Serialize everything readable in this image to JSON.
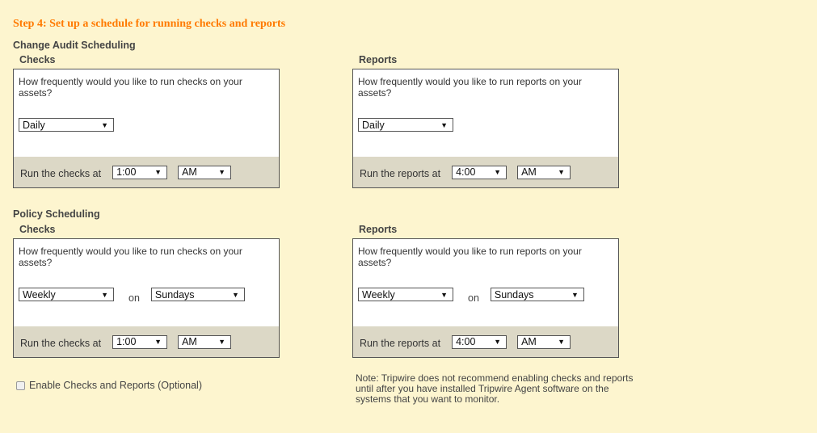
{
  "step_title": "Step 4: Set up a schedule for running checks and reports",
  "question_text": "How frequently would you like to run checks on your assets?",
  "sections": [
    {
      "title": "Change Audit Scheduling",
      "checks": {
        "label": "Checks",
        "question": "How frequently would you like to run checks on your assets?",
        "frequency": "Daily",
        "run_label": "Run the checks at",
        "time": "1:00",
        "ampm": "AM"
      },
      "reports": {
        "label": "Reports",
        "question": "How frequently would you like to run reports on your assets?",
        "frequency": "Daily",
        "run_label": "Run the reports at",
        "time": "4:00",
        "ampm": "AM"
      }
    },
    {
      "title": "Policy Scheduling",
      "checks": {
        "label": "Checks",
        "question": "How frequently would you like to run checks on your assets?",
        "frequency": "Weekly",
        "on_label": "on",
        "day": "Sundays",
        "run_label": "Run the checks at",
        "time": "1:00",
        "ampm": "AM"
      },
      "reports": {
        "label": "Reports",
        "question": "How frequently would you like to run reports on your assets?",
        "frequency": "Weekly",
        "on_label": "on",
        "day": "Sundays",
        "run_label": "Run the reports at",
        "time": "4:00",
        "ampm": "AM"
      }
    }
  ],
  "enable_label": "Enable Checks and Reports (Optional)",
  "enable_checked": false,
  "note": "Note: Tripwire does not recommend enabling checks and reports until after you have installed Tripwire Agent software on the systems that you want to monitor.",
  "dropdown_arrow": "▼"
}
